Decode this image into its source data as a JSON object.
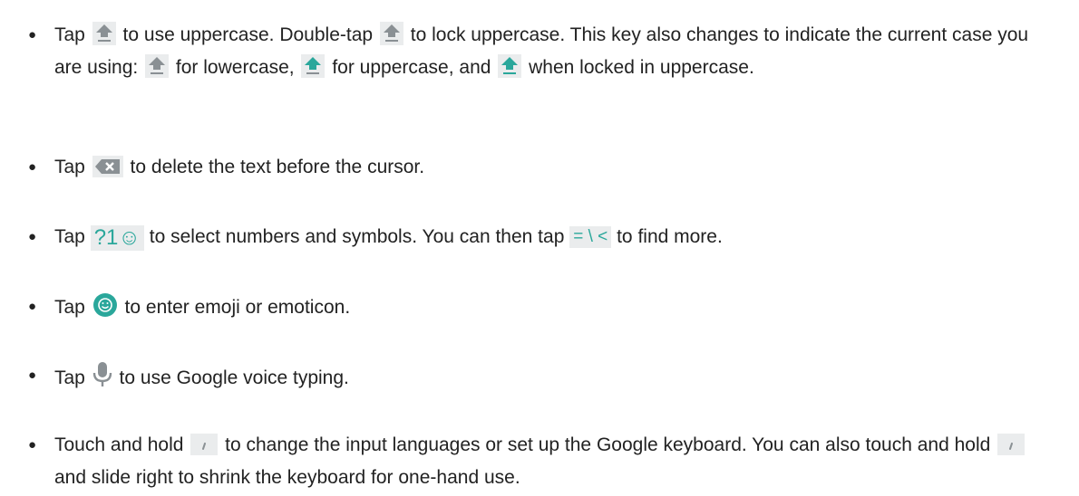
{
  "items": [
    {
      "parts": [
        "Tap",
        "to use uppercase. Double-tap",
        "to lock uppercase. This key also changes to indicate the current case you are using:",
        "for lowercase,",
        "for uppercase, and",
        "when locked in uppercase."
      ]
    },
    {
      "parts": [
        "Tap",
        "to delete the text before the cursor."
      ]
    },
    {
      "parts": [
        "Tap",
        "to select numbers and symbols. You can then tap",
        "to find more."
      ]
    },
    {
      "parts": [
        "Tap",
        "to enter emoji or emoticon."
      ]
    },
    {
      "parts": [
        "Tap",
        "to use Google voice typing."
      ]
    },
    {
      "parts": [
        "Touch and hold",
        "to change the input languages or set up the Google keyboard. You can also touch and hold",
        "and slide right to shrink the keyboard for one-hand use."
      ]
    }
  ],
  "symbols": {
    "numbers_key": "?1☺",
    "more_key": "= \\ <"
  },
  "bullet": "●",
  "colors": {
    "accent": "#2aa79b",
    "key_gray": "#8a9094",
    "key_bg": "#eaeced"
  },
  "icons": [
    "shift-icon",
    "backspace-icon",
    "numbers-symbols-key-icon",
    "more-symbols-key-icon",
    "emoji-icon",
    "microphone-icon",
    "comma-key-icon"
  ]
}
